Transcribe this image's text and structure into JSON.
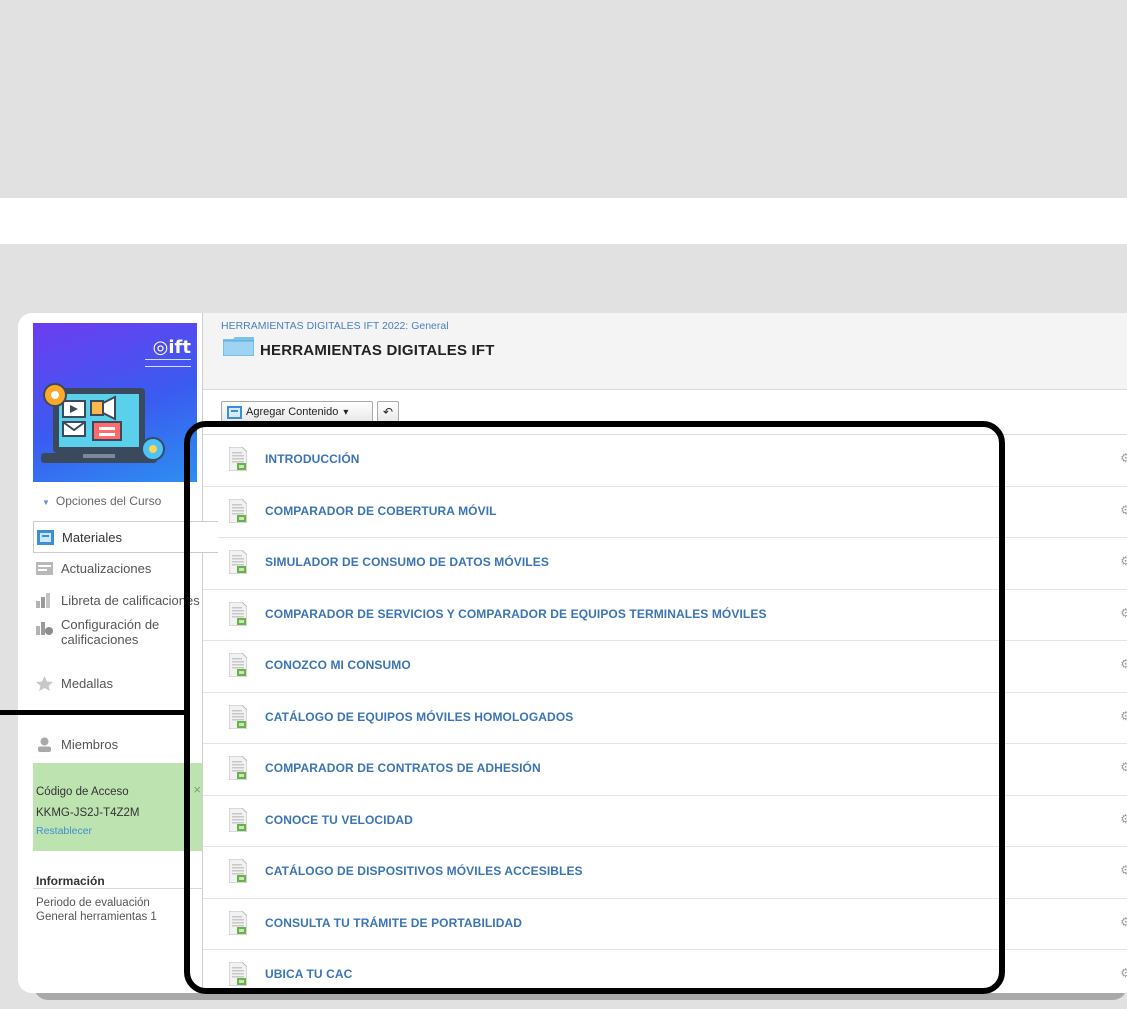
{
  "brand": {
    "logo_text": "ift"
  },
  "course_menu": {
    "options_label": "Opciones del Curso",
    "items": [
      {
        "label": "Materiales",
        "icon": "materials-icon",
        "active": true
      },
      {
        "label": "Actualizaciones",
        "icon": "updates-icon"
      },
      {
        "label": "Libreta de calificaciones",
        "icon": "gradebook-icon"
      },
      {
        "label": "Configuración de calificaciones",
        "icon": "grade-settings-icon"
      },
      {
        "label": "Medallas",
        "icon": "badges-icon"
      },
      {
        "label": "Miembros",
        "icon": "members-icon"
      }
    ]
  },
  "access_code": {
    "title": "Código de Acceso",
    "code": "KKMG-JS2J-T4Z2M",
    "reset_label": "Restablecer",
    "close_glyph": "×"
  },
  "info": {
    "title": "Información",
    "line1": "Periodo de evaluación",
    "line2": "General herramientas 1"
  },
  "header": {
    "breadcrumb": "HERRAMIENTAS DIGITALES IFT 2022: General",
    "title": "HERRAMIENTAS DIGITALES IFT"
  },
  "toolbar": {
    "add_content_label": "Agregar Contenido",
    "dropdown_glyph": "▾",
    "back_glyph": "↶"
  },
  "materials": [
    {
      "title": "INTRODUCCIÓN"
    },
    {
      "title": "COMPARADOR DE COBERTURA MÓVIL"
    },
    {
      "title": "SIMULADOR DE CONSUMO DE DATOS MÓVILES"
    },
    {
      "title": "COMPARADOR DE SERVICIOS Y COMPARADOR DE EQUIPOS TERMINALES MÓVILES"
    },
    {
      "title": "CONOZCO MI CONSUMO"
    },
    {
      "title": "CATÁLOGO DE EQUIPOS MÓVILES HOMOLOGADOS"
    },
    {
      "title": "COMPARADOR DE CONTRATOS DE ADHESIÓN"
    },
    {
      "title": "CONOCE TU VELOCIDAD"
    },
    {
      "title": "CATÁLOGO DE DISPOSITIVOS MÓVILES ACCESIBLES"
    },
    {
      "title": "CONSULTA TU TRÁMITE DE PORTABILIDAD"
    },
    {
      "title": "UBICA TU CAC"
    }
  ],
  "row_gear_glyph": "⚙▾",
  "colors": {
    "link_blue": "#3a74b5",
    "highlight": "#000000",
    "code_box_green": "#bde3b0",
    "banner_purple": "#6d3cf0"
  }
}
